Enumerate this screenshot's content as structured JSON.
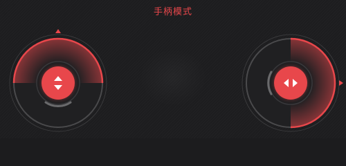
{
  "header": {
    "title": "手柄模式"
  },
  "joysticks": {
    "left": {
      "icon": "up-down-arrows-icon",
      "edge_indicator_icon": "triangle-up-icon"
    },
    "right": {
      "icon": "left-right-arrows-icon",
      "edge_indicator_icon": "triangle-right-icon"
    }
  },
  "colors": {
    "accent": "#e8474b",
    "background": "#1d1d1f",
    "ring": "#4a4a4c"
  }
}
